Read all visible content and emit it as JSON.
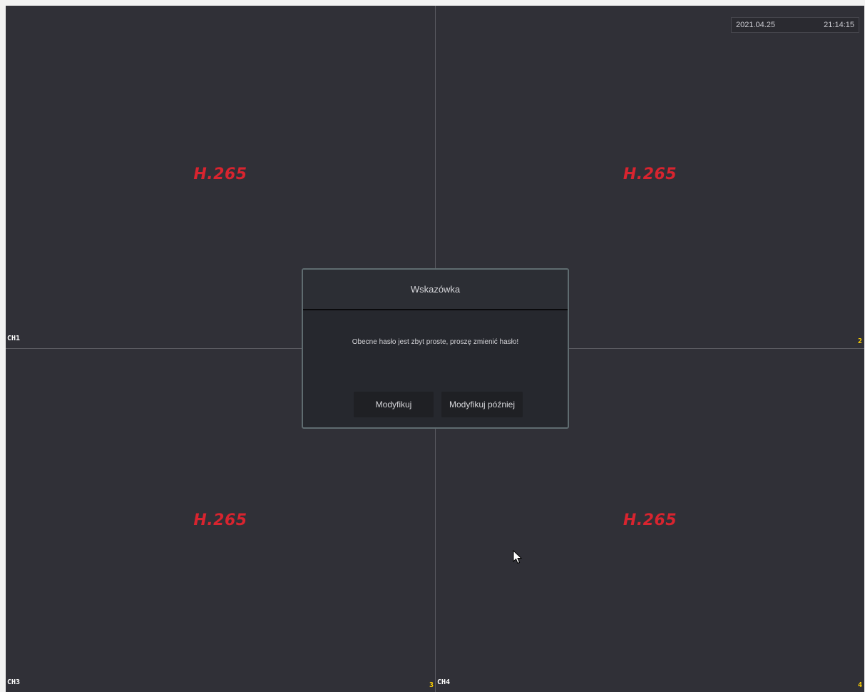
{
  "overlay": {
    "date": "2021.04.25",
    "time": "21:14:15"
  },
  "channels": [
    {
      "label": "CH1",
      "number": "",
      "codec": "H.265"
    },
    {
      "label": "",
      "number": "2",
      "codec": "H.265"
    },
    {
      "label": "CH3",
      "number": "3",
      "codec": "H.265"
    },
    {
      "label": "CH4",
      "number": "4",
      "codec": "H.265"
    }
  ],
  "dialog": {
    "title": "Wskazówka",
    "message": "Obecne hasło jest zbyt proste, proszę zmienić hasło!",
    "buttons": {
      "modify": "Modyfikuj",
      "modify_later": "Modyfikuj później"
    }
  },
  "colors": {
    "background": "#303037",
    "codec_text": "#d8242f",
    "channel_number": "#ffd200"
  },
  "icons": {
    "cursor": "mouse-pointer-icon"
  }
}
